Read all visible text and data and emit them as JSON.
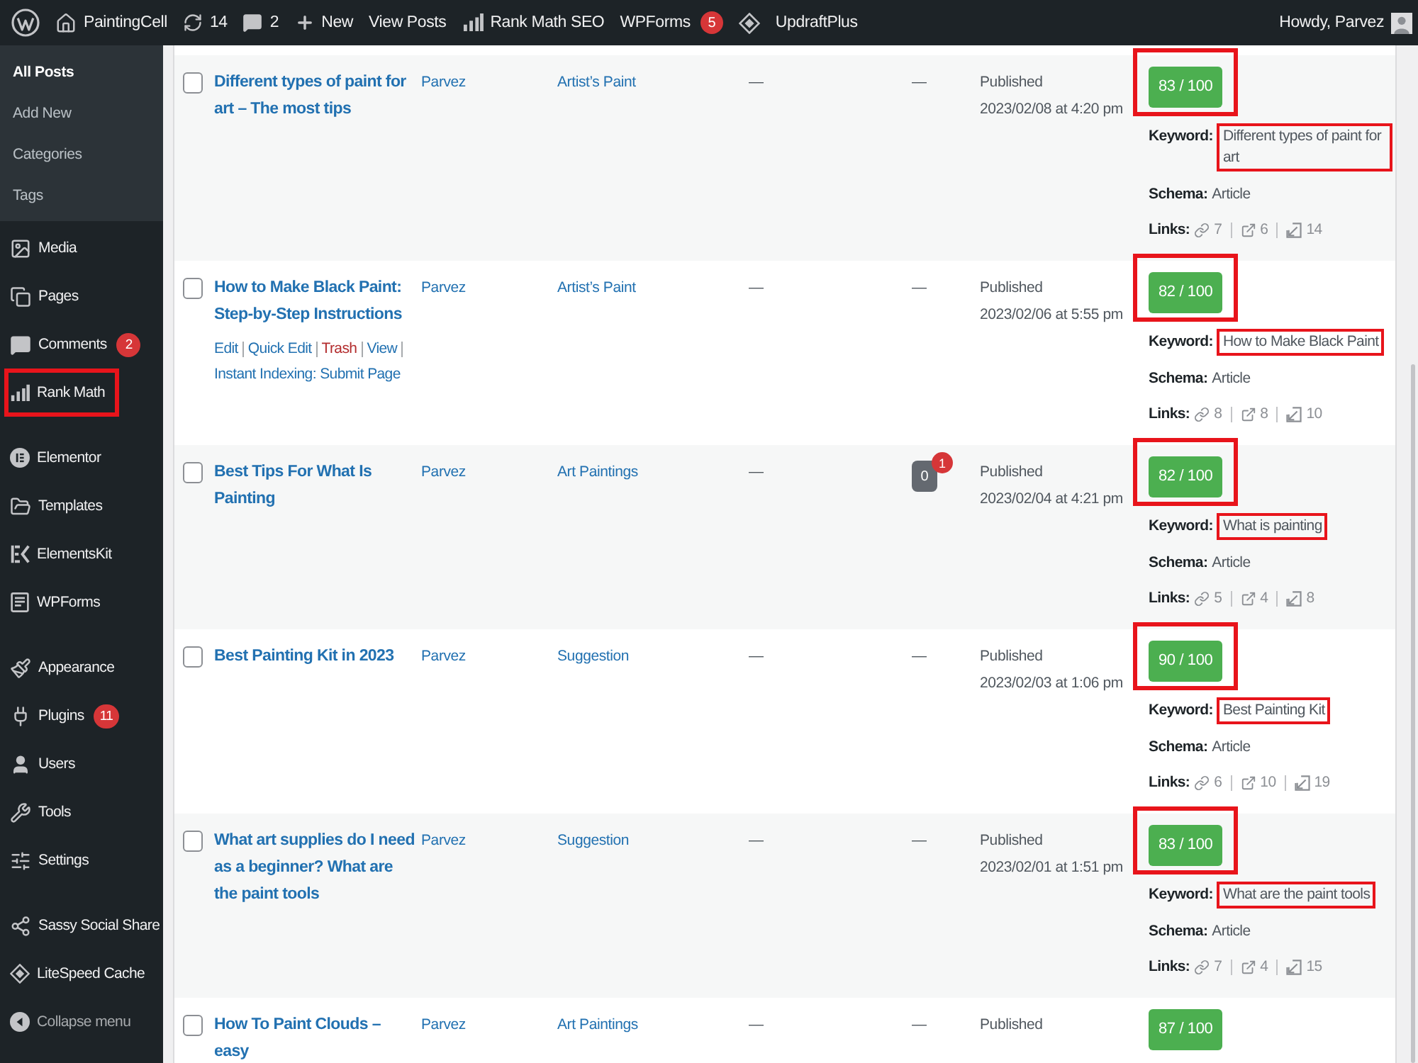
{
  "admin_bar": {
    "items": [
      {
        "kind": "logo"
      },
      {
        "kind": "site",
        "label": "PaintingCell"
      },
      {
        "kind": "updates",
        "label": "14"
      },
      {
        "kind": "comments",
        "label": "2"
      },
      {
        "kind": "new",
        "label": "New"
      },
      {
        "kind": "text",
        "label": "View Posts"
      },
      {
        "kind": "rankmath",
        "label": "Rank Math SEO"
      },
      {
        "kind": "text",
        "label": "WPForms",
        "badge": "5"
      },
      {
        "kind": "diamond"
      },
      {
        "kind": "text",
        "label": "UpdraftPlus"
      }
    ],
    "greeting": "Howdy, Parvez"
  },
  "sidebar": {
    "submenu": [
      {
        "label": "All Posts",
        "selected": true
      },
      {
        "label": "Add New",
        "selected": false
      },
      {
        "label": "Categories",
        "selected": false
      },
      {
        "label": "Tags",
        "selected": false
      }
    ],
    "menu_groups": [
      {
        "items": [
          {
            "kind": "media",
            "label": "Media",
            "highlighted": false
          },
          {
            "kind": "pages",
            "label": "Pages",
            "highlighted": false
          },
          {
            "kind": "comments",
            "label": "Comments",
            "badge": "2",
            "highlighted": false
          },
          {
            "kind": "rankmath",
            "label": "Rank Math",
            "highlighted": true
          }
        ]
      },
      {
        "items": [
          {
            "kind": "elementor",
            "label": "Elementor",
            "highlighted": false
          },
          {
            "kind": "templates",
            "label": "Templates",
            "highlighted": false
          },
          {
            "kind": "elementskit",
            "label": "ElementsKit",
            "highlighted": false
          },
          {
            "kind": "forms",
            "label": "WPForms",
            "highlighted": false
          }
        ]
      },
      {
        "items": [
          {
            "kind": "appearance",
            "label": "Appearance",
            "highlighted": false
          },
          {
            "kind": "plugins",
            "label": "Plugins",
            "badge": "11",
            "highlighted": false
          },
          {
            "kind": "users",
            "label": "Users",
            "highlighted": false
          },
          {
            "kind": "tools",
            "label": "Tools",
            "highlighted": false
          },
          {
            "kind": "settings",
            "label": "Settings",
            "highlighted": false
          }
        ]
      },
      {
        "items": [
          {
            "kind": "share",
            "label": "Sassy Social Share",
            "highlighted": false
          },
          {
            "kind": "litespeed",
            "label": "LiteSpeed Cache",
            "highlighted": false
          },
          {
            "kind": "collapse",
            "label": "Collapse menu",
            "highlighted": false
          }
        ]
      }
    ]
  },
  "posts": {
    "rows": [
      {
        "checked": false,
        "title": "Different types of paint for art – The most tips",
        "author": "Parvez",
        "category": "Artist’s Paint",
        "tags": "—",
        "comments": {
          "kind": "dash",
          "text": "—"
        },
        "status": "Published",
        "date": "2023/02/08 at 4:20 pm",
        "seo": {
          "score": "83 / 100",
          "score_highlighted": true,
          "keyword_label": "Keyword:",
          "keyword": "Different types of paint for art",
          "keyword_highlighted": true,
          "schema_label": "Schema:",
          "schema": "Article",
          "links_label": "Links:",
          "links": [
            {
              "kind": "internal",
              "count": "7"
            },
            {
              "kind": "external",
              "count": "6"
            },
            {
              "kind": "incoming",
              "count": "14"
            }
          ]
        }
      },
      {
        "checked": false,
        "title": "How to Make Black Paint: Step-by-Step Instructions",
        "actions": [
          {
            "kind": "link",
            "label": "Edit"
          },
          {
            "kind": "link",
            "label": "Quick Edit"
          },
          {
            "kind": "danger",
            "label": "Trash"
          },
          {
            "kind": "link",
            "label": "View"
          },
          {
            "kind": "link",
            "label": "Instant Indexing: Submit Page"
          }
        ],
        "author": "Parvez",
        "category": "Artist’s Paint",
        "tags": "—",
        "comments": {
          "kind": "dash",
          "text": "—"
        },
        "status": "Published",
        "date": "2023/02/06 at 5:55 pm",
        "seo": {
          "score": "82 / 100",
          "score_highlighted": true,
          "keyword_label": "Keyword:",
          "keyword": "How to Make Black Paint",
          "keyword_highlighted": true,
          "schema_label": "Schema:",
          "schema": "Article",
          "links_label": "Links:",
          "links": [
            {
              "kind": "internal",
              "count": "8"
            },
            {
              "kind": "external",
              "count": "8"
            },
            {
              "kind": "incoming",
              "count": "10"
            }
          ]
        }
      },
      {
        "checked": false,
        "title": "Best Tips For What Is Painting",
        "author": "Parvez",
        "category": "Art Paintings",
        "tags": "—",
        "comments": {
          "kind": "bubble",
          "count": "0",
          "pending": "1"
        },
        "status": "Published",
        "date": "2023/02/04 at 4:21 pm",
        "seo": {
          "score": "82 / 100",
          "score_highlighted": true,
          "keyword_label": "Keyword:",
          "keyword": "What is painting",
          "keyword_highlighted": true,
          "schema_label": "Schema:",
          "schema": "Article",
          "links_label": "Links:",
          "links": [
            {
              "kind": "internal",
              "count": "5"
            },
            {
              "kind": "external",
              "count": "4"
            },
            {
              "kind": "incoming",
              "count": "8"
            }
          ]
        }
      },
      {
        "checked": false,
        "title": "Best Painting Kit in 2023",
        "author": "Parvez",
        "category": "Suggestion",
        "tags": "—",
        "comments": {
          "kind": "dash",
          "text": "—"
        },
        "status": "Published",
        "date": "2023/02/03 at 1:06 pm",
        "seo": {
          "score": "90 / 100",
          "score_highlighted": true,
          "keyword_label": "Keyword:",
          "keyword": "Best Painting Kit",
          "keyword_highlighted": true,
          "schema_label": "Schema:",
          "schema": "Article",
          "links_label": "Links:",
          "links": [
            {
              "kind": "internal",
              "count": "6"
            },
            {
              "kind": "external",
              "count": "10"
            },
            {
              "kind": "incoming",
              "count": "19"
            }
          ]
        }
      },
      {
        "checked": false,
        "title": "What art supplies do I need as a beginner? What are the paint tools",
        "author": "Parvez",
        "category": "Suggestion",
        "tags": "—",
        "comments": {
          "kind": "dash",
          "text": "—"
        },
        "status": "Published",
        "date": "2023/02/01 at 1:51 pm",
        "seo": {
          "score": "83 / 100",
          "score_highlighted": true,
          "keyword_label": "Keyword:",
          "keyword": "What are the paint tools",
          "keyword_highlighted": true,
          "schema_label": "Schema:",
          "schema": "Article",
          "links_label": "Links:",
          "links": [
            {
              "kind": "internal",
              "count": "7"
            },
            {
              "kind": "external",
              "count": "4"
            },
            {
              "kind": "incoming",
              "count": "15"
            }
          ]
        }
      },
      {
        "checked": false,
        "title": "How To Paint Clouds – easy",
        "author": "Parvez",
        "category": "Art Paintings",
        "tags": "—",
        "comments": {
          "kind": "dash",
          "text": "—"
        },
        "status": "Published",
        "seo": {
          "score": "87 / 100",
          "score_highlighted": false
        }
      }
    ]
  }
}
